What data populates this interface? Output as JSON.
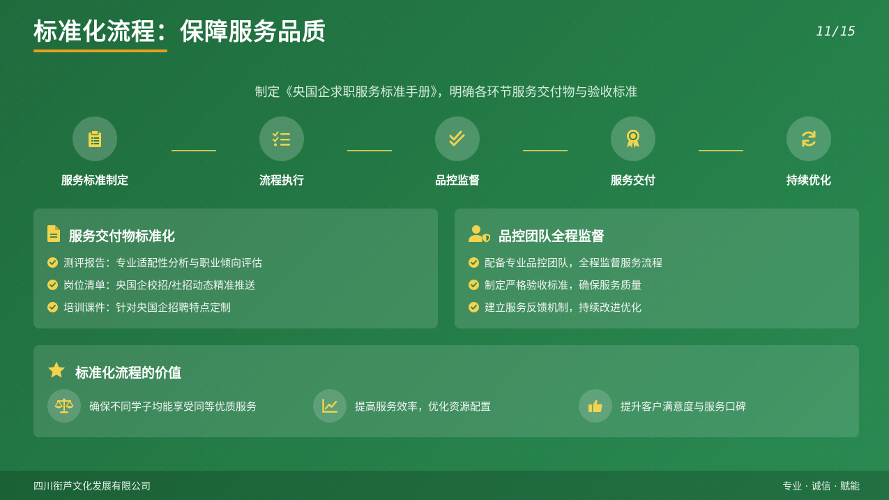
{
  "header": {
    "title": "标准化流程：保障服务品质",
    "page_indicator": "11/15"
  },
  "subtitle": "制定《央国企求职服务标准手册》，明确各环节服务交付物与验收标准",
  "steps": [
    {
      "label": "服务标准制定",
      "icon": "clipboard-icon"
    },
    {
      "label": "流程执行",
      "icon": "checklist-icon"
    },
    {
      "label": "品控监督",
      "icon": "double-check-icon"
    },
    {
      "label": "服务交付",
      "icon": "award-icon"
    },
    {
      "label": "持续优化",
      "icon": "refresh-icon"
    }
  ],
  "deliverables_card": {
    "title": "服务交付物标准化",
    "icon": "document-icon",
    "items": [
      "测评报告：专业适配性分析与职业倾向评估",
      "岗位清单：央国企校招/社招动态精准推送",
      "培训课件：针对央国企招聘特点定制"
    ]
  },
  "qc_card": {
    "title": "品控团队全程监督",
    "icon": "user-shield-icon",
    "items": [
      "配备专业品控团队，全程监督服务流程",
      "制定严格验收标准，确保服务质量",
      "建立服务反馈机制，持续改进优化"
    ]
  },
  "value_card": {
    "title": "标准化流程的价值",
    "icon": "star-icon",
    "items": [
      {
        "text": "确保不同学子均能享受同等优质服务",
        "icon": "balance-scale-icon"
      },
      {
        "text": "提高服务效率，优化资源配置",
        "icon": "chart-line-icon"
      },
      {
        "text": "提升客户满意度与服务口碑",
        "icon": "thumbs-up-icon"
      }
    ]
  },
  "footer": {
    "company": "四川衔芦文化发展有限公司",
    "tagline": "专业 · 诚信 · 赋能"
  },
  "colors": {
    "background": "#237a45",
    "accent_orange": "#e8a020",
    "accent_yellow": "#f2d34f"
  }
}
